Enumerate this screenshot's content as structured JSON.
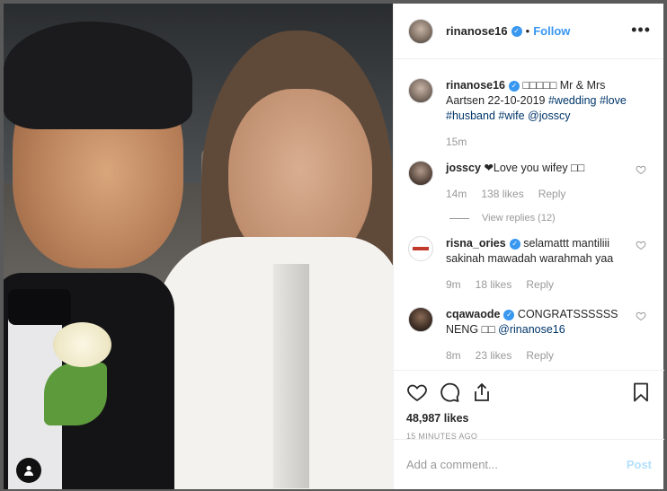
{
  "header": {
    "username": "rinanose16",
    "separator": "•",
    "follow_label": "Follow",
    "more_label": "•••"
  },
  "caption": {
    "username": "rinanose16",
    "text": "□□□□□ Mr & Mrs Aartsen 22-10-2019 ",
    "tags": "#wedding #love #husband #wife @josscy",
    "time": "15m"
  },
  "comments": [
    {
      "username": "josscy",
      "text": "❤Love you wifey □□",
      "time": "14m",
      "likes": "138 likes",
      "reply": "Reply",
      "view_replies": "View replies (12)"
    },
    {
      "username": "risna_ories",
      "text": "selamattt mantiliii sakinah mawadah warahmah yaa",
      "time": "9m",
      "likes": "18 likes",
      "reply": "Reply"
    },
    {
      "username": "cqawaode",
      "text": "CONGRATSSSSSS NENG □□ ",
      "tag": "@rinanose16",
      "time": "8m",
      "likes": "23 likes",
      "reply": "Reply"
    }
  ],
  "post": {
    "likes": "48,987 likes",
    "posted_ago": "15 MINUTES AGO"
  },
  "add_comment": {
    "placeholder": "Add a comment...",
    "post_label": "Post"
  },
  "icons": [
    "heart-icon",
    "comment-icon",
    "share-icon",
    "bookmark-icon",
    "verified-icon",
    "user-tag-icon"
  ],
  "colors": {
    "link_blue": "#3897f0",
    "verified_blue": "#3897f0",
    "muted": "#999999",
    "post_disabled": "#b2dffc"
  }
}
